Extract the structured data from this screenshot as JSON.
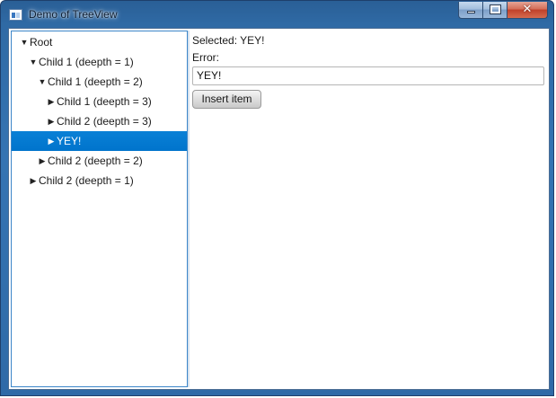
{
  "window": {
    "title": "Demo of TreeView",
    "caption": {
      "minimize_icon": "minimize-icon",
      "maximize_icon": "maximize-icon",
      "close_icon": "close-icon",
      "close_glyph": "✕"
    }
  },
  "tree": {
    "items": [
      {
        "label": "Root",
        "depth": 0,
        "expanded": true,
        "selected": false
      },
      {
        "label": "Child 1 (deepth = 1)",
        "depth": 1,
        "expanded": true,
        "selected": false
      },
      {
        "label": "Child 1 (deepth = 2)",
        "depth": 2,
        "expanded": true,
        "selected": false
      },
      {
        "label": "Child 1 (deepth = 3)",
        "depth": 3,
        "expanded": false,
        "selected": false
      },
      {
        "label": "Child 2 (deepth = 3)",
        "depth": 3,
        "expanded": false,
        "selected": false
      },
      {
        "label": "YEY!",
        "depth": 3,
        "expanded": false,
        "selected": true
      },
      {
        "label": "Child 2 (deepth = 2)",
        "depth": 2,
        "expanded": false,
        "selected": false
      },
      {
        "label": "Child 2 (deepth = 1)",
        "depth": 1,
        "expanded": false,
        "selected": false
      }
    ],
    "expanded_glyph": "▼",
    "collapsed_glyph": "▶"
  },
  "details": {
    "selected_text": "Selected: YEY!",
    "error_text": "Error:",
    "input_value": "YEY!",
    "insert_button_label": "Insert item"
  },
  "colors": {
    "selection": "#0a80d6",
    "tree_border": "#3c86c9",
    "titlebar": "#3574b3"
  }
}
